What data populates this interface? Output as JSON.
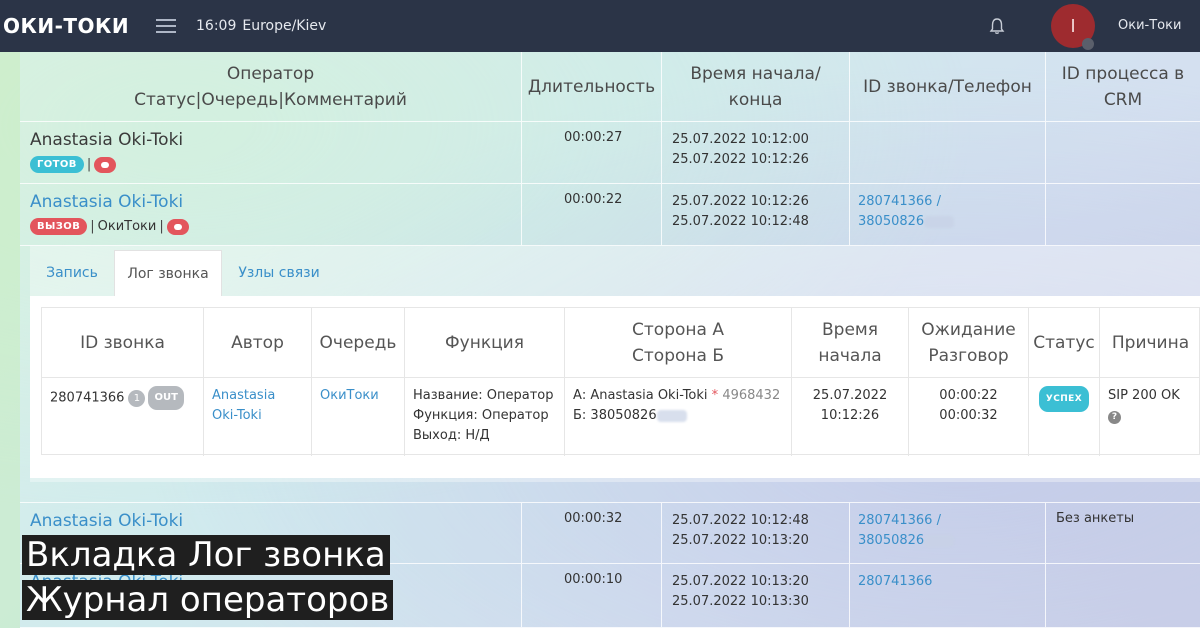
{
  "app": {
    "logo": "ОКИ-ТОКИ",
    "time": "16:09",
    "timezone": "Europe/Kiev",
    "avatar_letter": "I",
    "user_name": "Оки-Токи"
  },
  "table": {
    "headers": {
      "operator_line1": "Оператор",
      "operator_line2": "Статус|Очередь|Комментарий",
      "duration": "Длительность",
      "time_line1": "Время начала/",
      "time_line2": "конца",
      "call_id": "ID звонка/Телефон",
      "crm_line1": "ID процесса в",
      "crm_line2": "CRM"
    },
    "rows": [
      {
        "operator": "Anastasia Oki-Toki",
        "status": "ГОТОВ",
        "queue": "",
        "duration": "00:00:27",
        "start": "25.07.2022 10:12:00",
        "end": "25.07.2022 10:12:26",
        "call_id": "",
        "phone": "",
        "crm": ""
      },
      {
        "operator": "Anastasia Oki-Toki",
        "status": "ВЫЗОВ",
        "queue": "ОкиТоки",
        "duration": "00:00:22",
        "start": "25.07.2022 10:12:26",
        "end": "25.07.2022 10:12:48",
        "call_id": "280741366 /",
        "phone": "38050826",
        "crm": ""
      },
      {
        "operator": "Anastasia Oki-Toki",
        "duration": "00:00:32",
        "start": "25.07.2022 10:12:48",
        "end": "25.07.2022 10:13:20",
        "call_id": "280741366 /",
        "phone": "38050826",
        "crm": "Без анкеты"
      },
      {
        "operator": "Anastasia Oki-Toki",
        "duration": "00:00:10",
        "start": "25.07.2022 10:13:20",
        "end": "25.07.2022 10:13:30",
        "call_id": "280741366",
        "crm": ""
      }
    ]
  },
  "panel": {
    "tabs": [
      "Запись",
      "Лог звонка",
      "Узлы связи"
    ],
    "log": {
      "headers": {
        "call_id": "ID звонка",
        "author": "Автор",
        "queue": "Очередь",
        "function": "Функция",
        "side_a": "Сторона А",
        "side_b": "Сторона Б",
        "time_line1": "Время",
        "time_line2": "начала",
        "wait_line1": "Ожидание",
        "wait_line2": "Разговор",
        "status": "Статус",
        "reason": "Причина"
      },
      "row": {
        "call_id": "280741366",
        "count": "1",
        "direction": "OUT",
        "author_line1": "Anastasia",
        "author_line2": "Oki-Toki",
        "queue": "ОкиТоки",
        "func_name": "Название: Оператор",
        "func_function": "Функция: Оператор",
        "func_exit": "Выход: Н/Д",
        "side_a_label": "А: Anastasia Oki-Toki",
        "side_a_ext": "4968432",
        "side_b": "Б: 38050826",
        "date": "25.07.2022",
        "time": "10:12:26",
        "wait": "00:00:22",
        "talk": "00:00:32",
        "status": "УСПЕХ",
        "reason": "SIP 200 OK"
      }
    }
  },
  "captions": {
    "line1": "Вкладка Лог звонка",
    "line2": "Журнал операторов"
  },
  "colors": {
    "topbar": "#2b3447",
    "link": "#3a8fc9",
    "green_badge": "#3bbfd4",
    "red_badge": "#e3555c",
    "avatar": "#9e2b2f"
  }
}
